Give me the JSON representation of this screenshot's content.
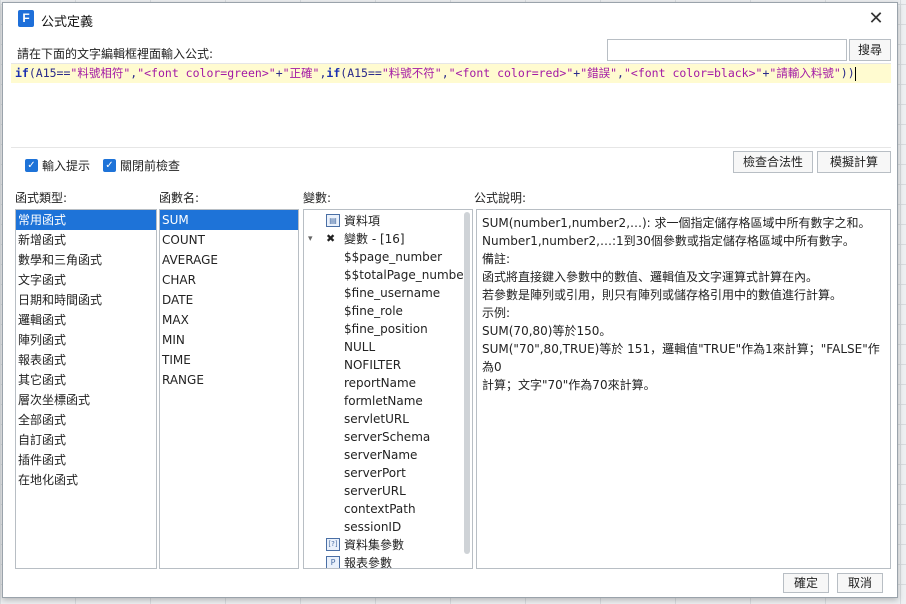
{
  "dialog": {
    "title": "公式定義",
    "prompt": "請在下面的文字編輯框裡面輸入公式:",
    "search_button": "搜尋",
    "search_placeholder": ""
  },
  "formula": {
    "segments": [
      {
        "t": "if",
        "c": "kw"
      },
      {
        "t": "(A15==",
        "c": "pl"
      },
      {
        "t": "\"料號相符\"",
        "c": "str"
      },
      {
        "t": ",",
        "c": "pl"
      },
      {
        "t": "\"<font color=green>\"",
        "c": "str"
      },
      {
        "t": "+",
        "c": "pl"
      },
      {
        "t": "\"正確\"",
        "c": "str"
      },
      {
        "t": ",",
        "c": "pl"
      },
      {
        "t": "if",
        "c": "kw"
      },
      {
        "t": "(A15==",
        "c": "pl"
      },
      {
        "t": "\"料號不符\"",
        "c": "str"
      },
      {
        "t": ",",
        "c": "pl"
      },
      {
        "t": "\"<font color=red>\"",
        "c": "str"
      },
      {
        "t": "+",
        "c": "pl"
      },
      {
        "t": "\"錯誤\"",
        "c": "str"
      },
      {
        "t": ",",
        "c": "pl"
      },
      {
        "t": "\"<font color=black>\"",
        "c": "str"
      },
      {
        "t": "+",
        "c": "pl"
      },
      {
        "t": "\"請輸入料號\"",
        "c": "str"
      },
      {
        "t": "))",
        "c": "pl"
      }
    ]
  },
  "options": {
    "input_hint": "輸入提示",
    "check_before_close": "關閉前檢查",
    "check_validity_button": "檢查合法性",
    "simulate_button": "模擬計算"
  },
  "columns": {
    "func_type": "函式類型:",
    "func_name": "函數名:",
    "variables": "變數:",
    "description": "公式說明:"
  },
  "func_types": [
    "常用函式",
    "新增函式",
    "數學和三角函式",
    "文字函式",
    "日期和時間函式",
    "邏輯函式",
    "陣列函式",
    "報表函式",
    "其它函式",
    "層次坐標函式",
    "全部函式",
    "自訂函式",
    "插件函式",
    "在地化函式"
  ],
  "func_names": [
    "SUM",
    "COUNT",
    "AVERAGE",
    "CHAR",
    "DATE",
    "MAX",
    "MIN",
    "TIME",
    "RANGE"
  ],
  "variables": {
    "data_item": "資料項",
    "var_group": "變數 - [16]",
    "vars": [
      "$$page_number",
      "$$totalPage_number",
      "$fine_username",
      "$fine_role",
      "$fine_position",
      "NULL",
      "NOFILTER",
      "reportName",
      "formletName",
      "servletURL",
      "serverSchema",
      "serverName",
      "serverPort",
      "serverURL",
      "contextPath",
      "sessionID"
    ],
    "dataset_params": "資料集參數",
    "report_params": "報表參數"
  },
  "description": {
    "lines": [
      "SUM(number1,number2,…): 求一個指定儲存格區域中所有數字之和。",
      "Number1,number2,…:1到30個參數或指定儲存格區域中所有數字。",
      "備註:",
      "函式將直接鍵入參數中的數值、邏輯值及文字運算式計算在內。",
      "若參數是陣列或引用，則只有陣列或儲存格引用中的數值進行計算。",
      "示例:",
      "SUM(70,80)等於150。",
      "SUM(\"70\",80,TRUE)等於 151，邏輯值\"TRUE\"作為1來計算；\"FALSE\"作為0",
      "計算；文字\"70\"作為70來計算。"
    ]
  },
  "footer": {
    "ok": "確定",
    "cancel": "取消"
  }
}
